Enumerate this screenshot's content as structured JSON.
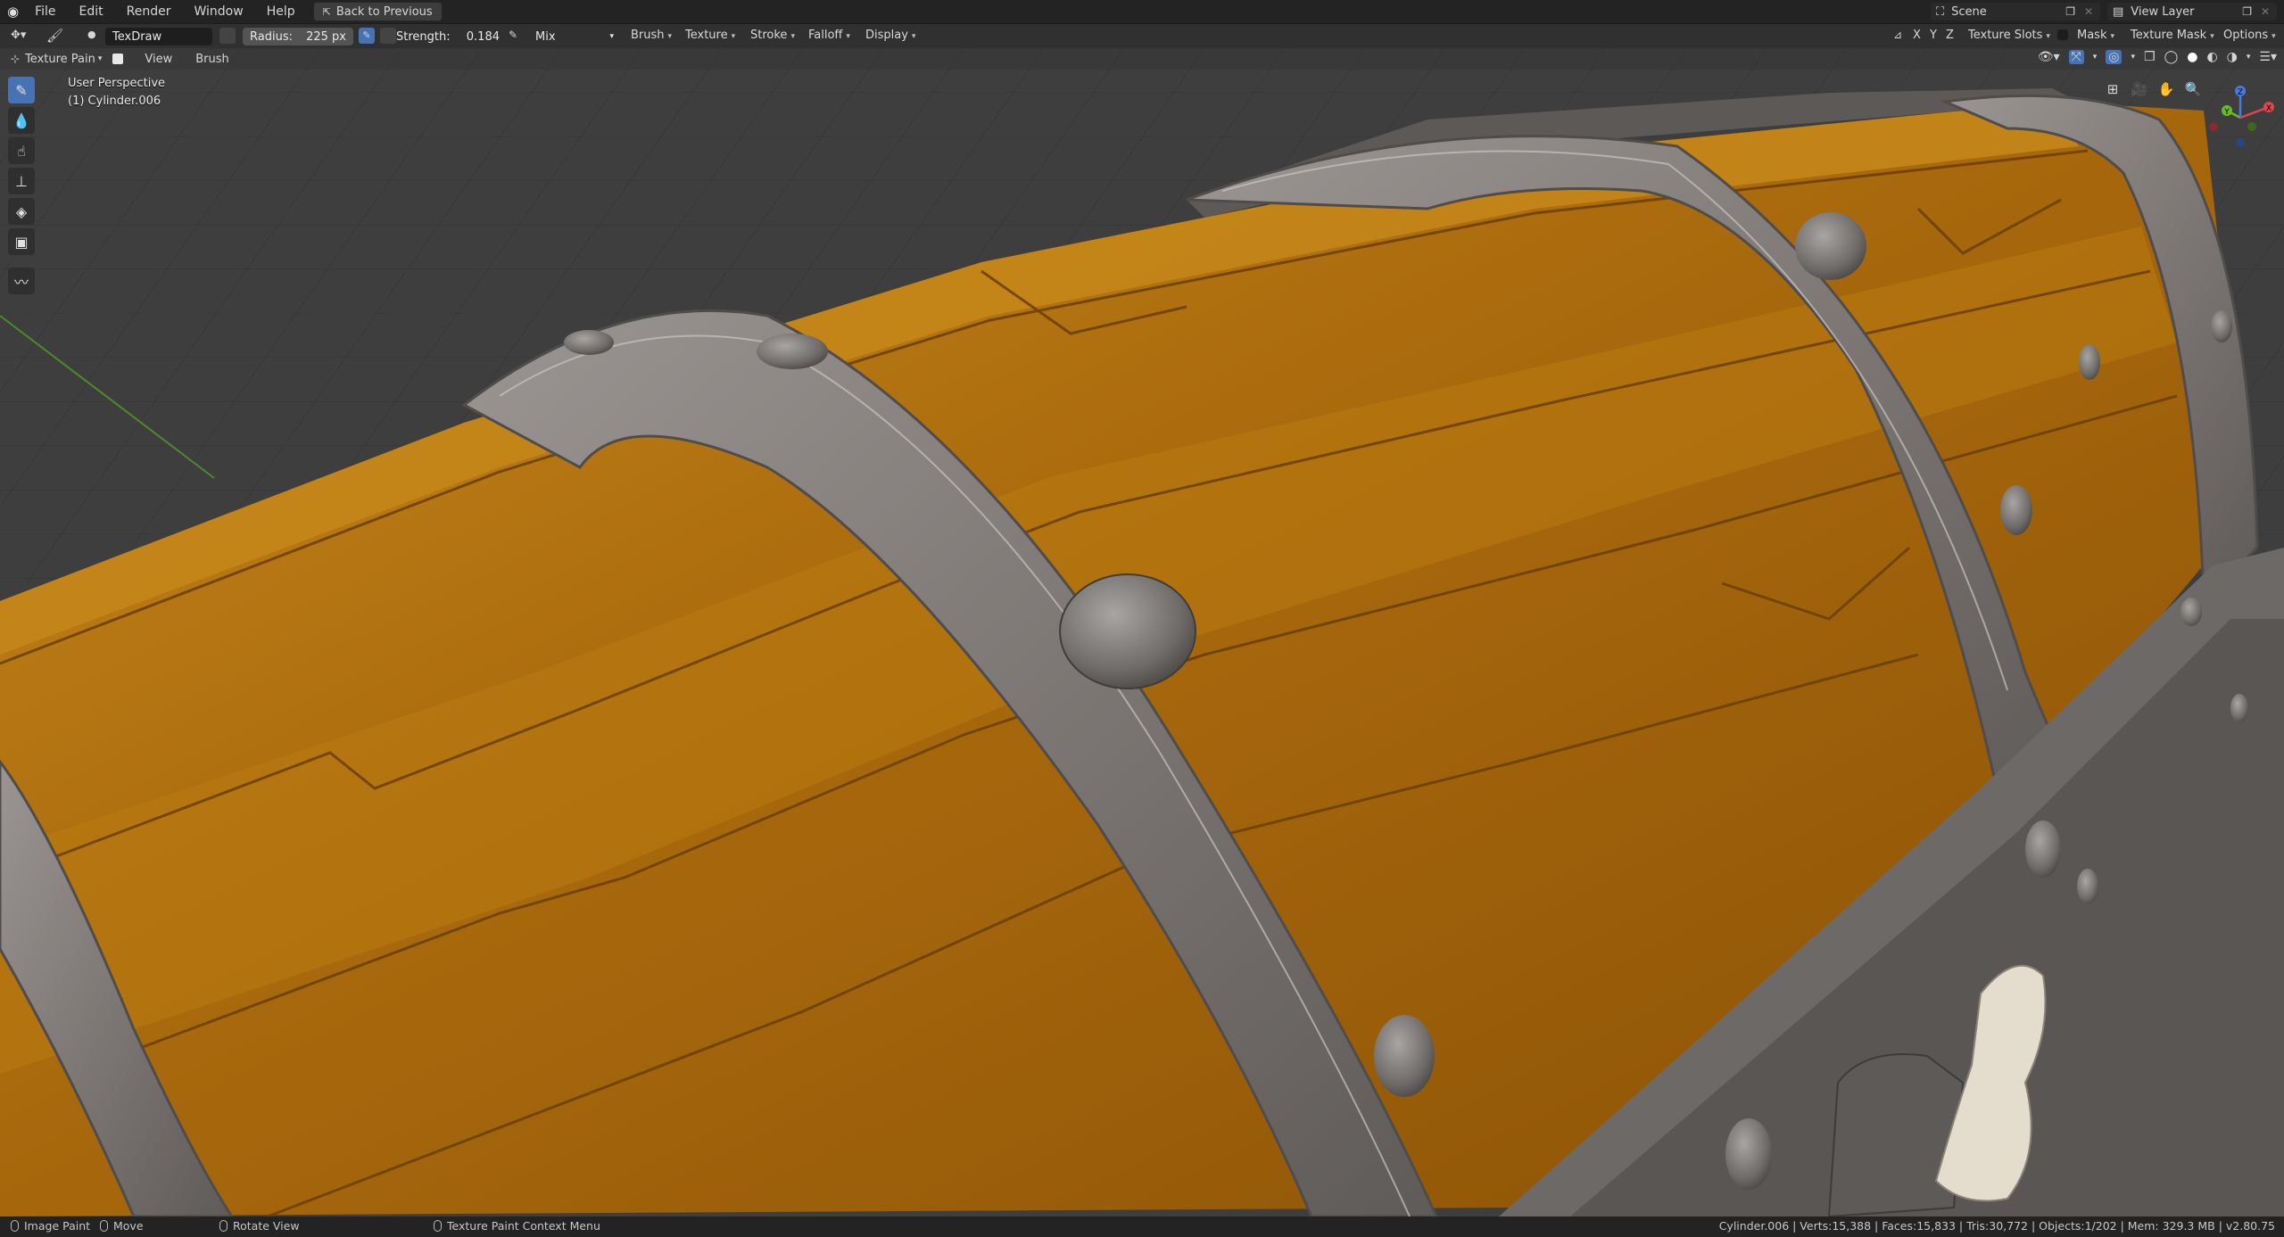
{
  "topbar": {
    "menus": [
      "File",
      "Edit",
      "Render",
      "Window",
      "Help"
    ],
    "back_button": "Back to Previous",
    "scene": "Scene",
    "view_layer": "View Layer"
  },
  "tool_header": {
    "brush_name": "TexDraw",
    "radius_label": "Radius:",
    "radius_value": "225 px",
    "strength_label": "Strength:",
    "strength_value": "0.184",
    "blend": "Mix",
    "dropdowns": [
      "Brush",
      "Texture",
      "Stroke",
      "Falloff",
      "Display"
    ],
    "axes": [
      "X",
      "Y",
      "Z"
    ],
    "texture_slots": "Texture Slots",
    "mask": "Mask",
    "texture_mask": "Texture Mask",
    "options": "Options"
  },
  "mode_header": {
    "mode": "Texture Pain",
    "view": "View",
    "brush": "Brush"
  },
  "viewport": {
    "perspective": "User Perspective",
    "object": "(1) Cylinder.006",
    "gizmo": {
      "x": "X",
      "y": "Y",
      "z": "Z"
    }
  },
  "tools": [
    "draw-icon",
    "soften-icon",
    "smear-icon",
    "clone-icon",
    "fill-icon",
    "mask-icon",
    "annotate-icon"
  ],
  "statusbar": {
    "image_paint": "Image Paint",
    "move": "Move",
    "rotate_view": "Rotate View",
    "context_menu": "Texture Paint Context Menu",
    "stats": "Cylinder.006 | Verts:15,388 | Faces:15,833 | Tris:30,772 | Objects:1/202 | Mem: 329.3 MB | v2.80.75"
  },
  "colors": {
    "accent": "#4772b3",
    "wood": "#b0700f",
    "metal": "#7a7572",
    "axis_x": "#e0444f",
    "axis_y": "#6cbb26",
    "axis_z": "#4a7ae0"
  }
}
